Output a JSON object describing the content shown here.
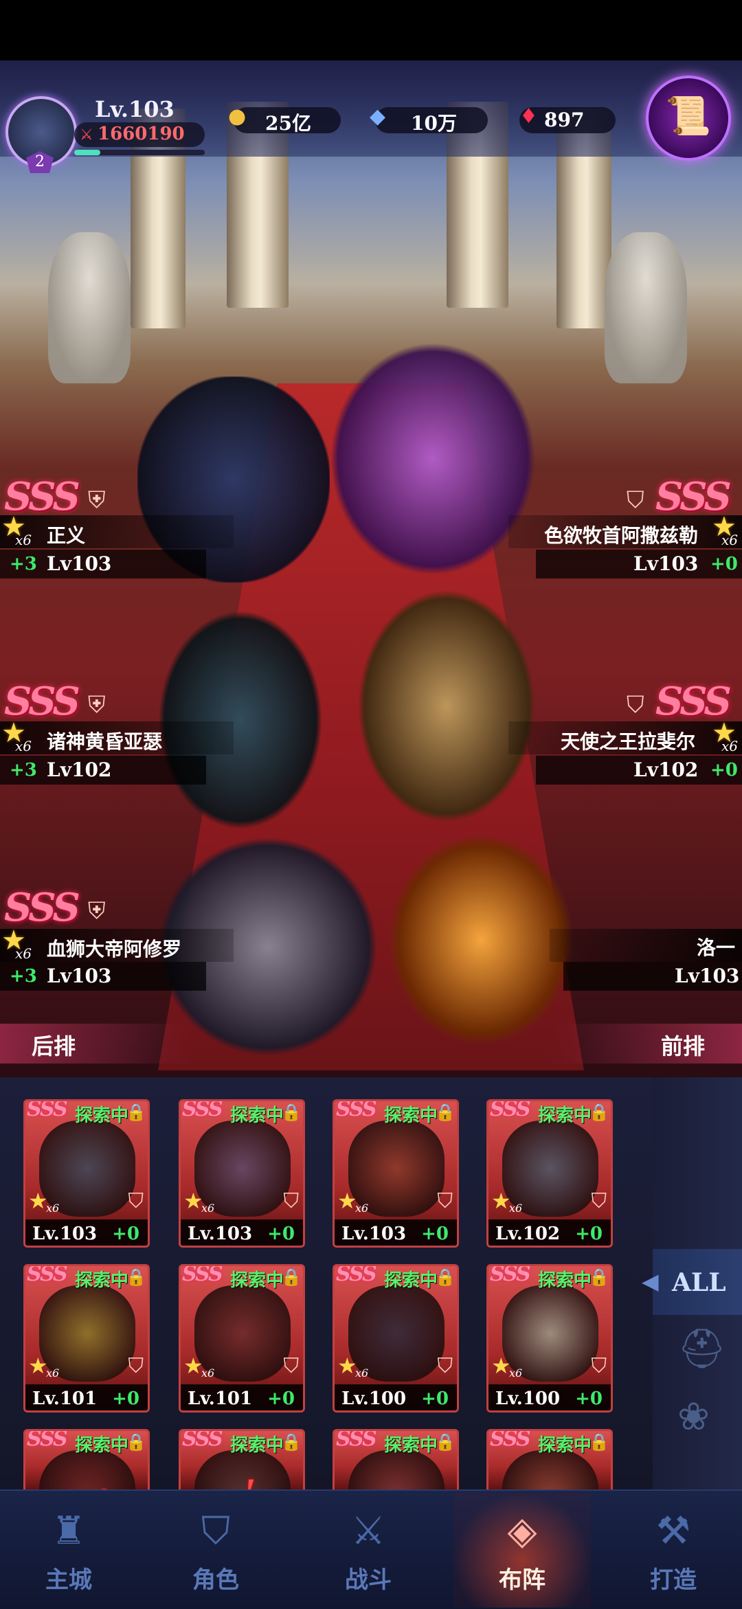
{
  "player": {
    "level": "Lv.103",
    "power": "1660190",
    "avatar_badge": "2",
    "exp_fraction": 0.2
  },
  "resources": [
    {
      "icon": "gold-icon",
      "value": "25亿"
    },
    {
      "icon": "diamond-icon",
      "value": "10万"
    },
    {
      "icon": "ruby-icon",
      "value": "897"
    }
  ],
  "formation": {
    "back_label": "后排",
    "front_label": "前排",
    "left": [
      {
        "rank": "SSS",
        "stars": "x6",
        "name": "正义",
        "bonus": "+3",
        "level": "Lv103"
      },
      {
        "rank": "SSS",
        "stars": "x6",
        "name": "诸神黄昏亚瑟",
        "bonus": "+3",
        "level": "Lv102"
      },
      {
        "rank": "SSS",
        "stars": "x6",
        "name": "血狮大帝阿修罗",
        "bonus": "+3",
        "level": "Lv103"
      }
    ],
    "right": [
      {
        "rank": "SSS",
        "stars": "x6",
        "name": "色欲牧首阿撒兹勒",
        "bonus": "+0",
        "level": "Lv103"
      },
      {
        "rank": "SSS",
        "stars": "x6",
        "name": "天使之王拉斐尔",
        "bonus": "+0",
        "level": "Lv102"
      },
      {
        "rank": "",
        "stars": "",
        "name": "洛一",
        "bonus": "",
        "level": "Lv103"
      }
    ]
  },
  "roster": {
    "status_label": "探索中",
    "rank": "SSS",
    "stars": "x6",
    "cards": [
      {
        "level": "Lv.103",
        "bonus": "+0"
      },
      {
        "level": "Lv.103",
        "bonus": "+0"
      },
      {
        "level": "Lv.103",
        "bonus": "+0"
      },
      {
        "level": "Lv.102",
        "bonus": "+0"
      },
      {
        "level": "Lv.101",
        "bonus": "+0"
      },
      {
        "level": "Lv.101",
        "bonus": "+0"
      },
      {
        "level": "Lv.100",
        "bonus": "+0"
      },
      {
        "level": "Lv.100",
        "bonus": "+0"
      },
      {
        "level": "",
        "bonus": ""
      },
      {
        "level": "",
        "bonus": ""
      },
      {
        "level": "",
        "bonus": ""
      },
      {
        "level": "",
        "bonus": ""
      }
    ],
    "filter_all": "ALL",
    "filter_icons": [
      "helmet-icon",
      "paw-icon"
    ]
  },
  "nav": [
    {
      "icon": "castle-icon",
      "label": "主城"
    },
    {
      "icon": "knight-helmet-icon",
      "label": "角色"
    },
    {
      "icon": "crossed-swords-icon",
      "label": "战斗"
    },
    {
      "icon": "formation-icon",
      "label": "布阵",
      "active": true
    },
    {
      "icon": "anvil-icon",
      "label": "打造"
    }
  ],
  "colors": {
    "accent_purple": "#c070ff",
    "rank_pink": "#ff7fa0",
    "bonus_green": "#3eea6a",
    "card_red": "#c24040",
    "nav_blue": "#4a6aa8"
  }
}
